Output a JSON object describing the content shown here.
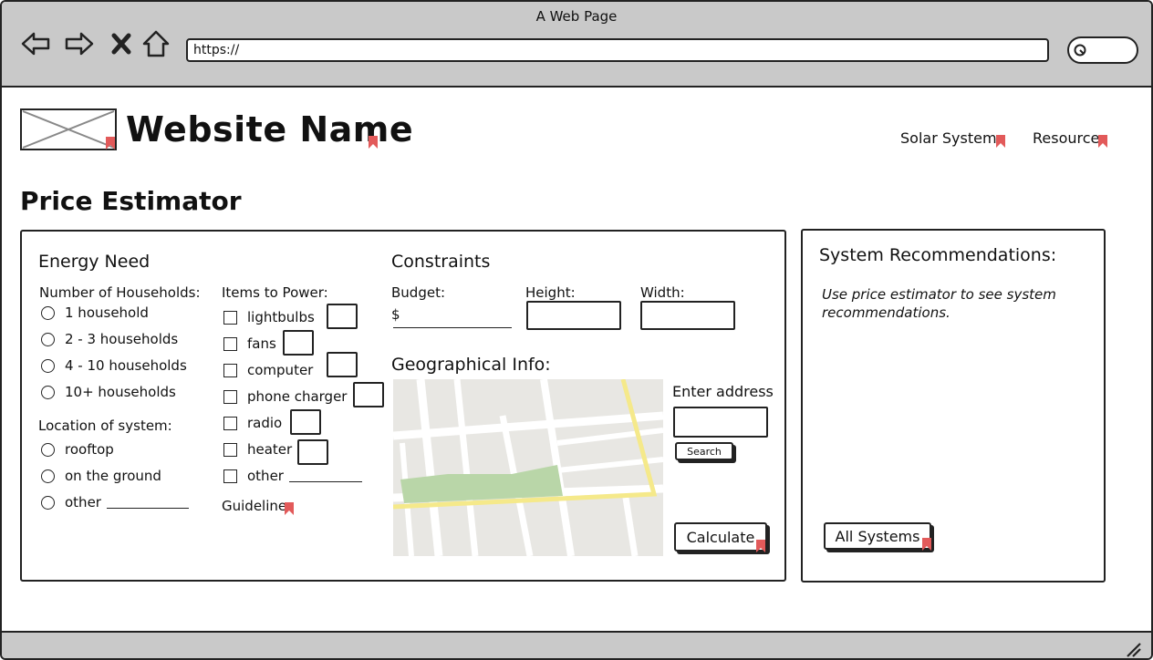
{
  "window": {
    "title": "A Web Page"
  },
  "browser": {
    "url": "https://"
  },
  "header": {
    "site_name": "Website Name",
    "nav": [
      "Solar Systems",
      "Resources"
    ]
  },
  "page_title": "Price Estimator",
  "energy": {
    "heading": "Energy Need",
    "households_label": "Number of Households:",
    "households_options": [
      "1 household",
      "2 - 3 households",
      "4 - 10 households",
      "10+ households"
    ],
    "location_label": "Location of system:",
    "location_options": [
      "rooftop",
      "on the ground",
      "other"
    ],
    "items_label": "Items to Power:",
    "items": [
      "lightbulbs",
      "fans",
      "computer",
      "phone charger",
      "radio",
      "heater",
      "other"
    ],
    "guidelines_link": "Guidelines"
  },
  "constraints": {
    "heading": "Constraints",
    "budget_label": "Budget:",
    "currency": "$",
    "height_label": "Height:",
    "width_label": "Width:"
  },
  "geo": {
    "heading": "Geographical Info:",
    "address_label": "Enter address",
    "search_button": "Search"
  },
  "calculate_button": "Calculate",
  "recommendations": {
    "title": "System Recommendations:",
    "placeholder_text": "Use price estimator to see system recommendations.",
    "all_systems_button": "All Systems"
  },
  "colors": {
    "chrome": "#c9c9c9",
    "map_bg": "#e8e7e3",
    "map_road": "#ffffff",
    "map_highway": "#f5e98a",
    "map_park": "#b9d6a8",
    "link_flag": "#e25a5a"
  }
}
